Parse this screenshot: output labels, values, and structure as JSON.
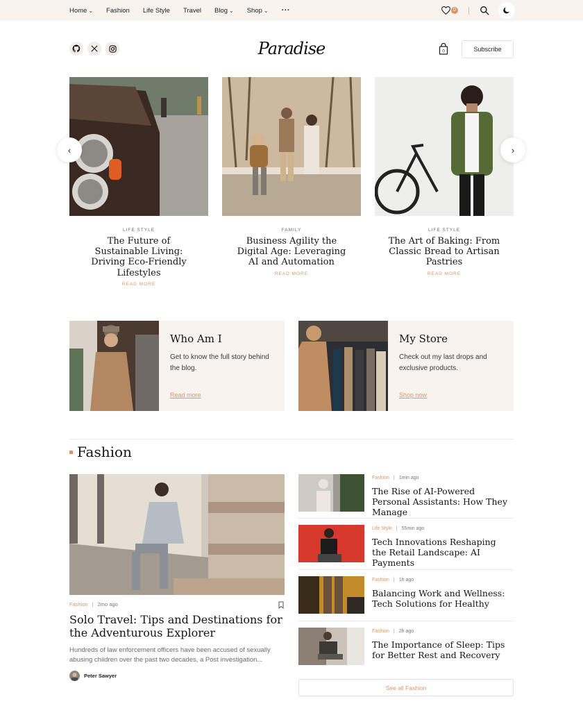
{
  "nav": {
    "items": [
      {
        "label": "Home",
        "dropdown": true
      },
      {
        "label": "Fashion",
        "dropdown": false
      },
      {
        "label": "Life Style",
        "dropdown": false
      },
      {
        "label": "Travel",
        "dropdown": false
      },
      {
        "label": "Blog",
        "dropdown": true
      },
      {
        "label": "Shop",
        "dropdown": true
      }
    ],
    "more_icon": "more-dots-icon",
    "wishlist_count": "0"
  },
  "header": {
    "logo_text": "Paradise",
    "subscribe_label": "Subscribe",
    "socials": [
      "github-icon",
      "x-icon",
      "instagram-icon"
    ]
  },
  "carousel": {
    "slides": [
      {
        "category": "LIFE STYLE",
        "title": "The Future of Sustainable Living: Driving Eco-Friendly Lifestyles",
        "more": "READ MORE"
      },
      {
        "category": "FAMILY",
        "title": "Business Agility the Digital Age: Leveraging AI and Automation",
        "more": "READ MORE"
      },
      {
        "category": "LIFE STYLE",
        "title": "The Art of Baking: From Classic Bread to Artisan Pastries",
        "more": "READ MORE"
      }
    ]
  },
  "promos": [
    {
      "title": "Who Am I",
      "text": "Get to know the full story behind the blog.",
      "link": "Read more"
    },
    {
      "title": "My Store",
      "text": "Check out my last drops and exclusive products.",
      "link": "Shop now"
    }
  ],
  "section": {
    "title": "Fashion"
  },
  "featured": {
    "category": "Fashion",
    "time": "2mo ago",
    "title": "Solo Travel: Tips and Destinations for the Adventurous Explorer",
    "excerpt": "Hundreds of law enforcement officers have been accused of sexually abusing children over the past two decades, a Post investigation...",
    "author": "Peter Sawyer"
  },
  "list": [
    {
      "category": "Fashion",
      "time": "1min ago",
      "title": "The Rise of AI-Powered Personal Assistants: How They Manage"
    },
    {
      "category": "Life Style",
      "time": "55min ago",
      "title": "Tech Innovations Reshaping the Retail Landscape: AI Payments"
    },
    {
      "category": "Fashion",
      "time": "1h ago",
      "title": "Balancing Work and Wellness: Tech Solutions for Healthy"
    },
    {
      "category": "Fashion",
      "time": "2h ago",
      "title": "The Importance of Sleep: Tips for Better Rest and Recovery"
    }
  ],
  "see_all_label": "See all Fashion",
  "colors": {
    "accent": "#d9956a",
    "cream": "#f8f3ef"
  }
}
